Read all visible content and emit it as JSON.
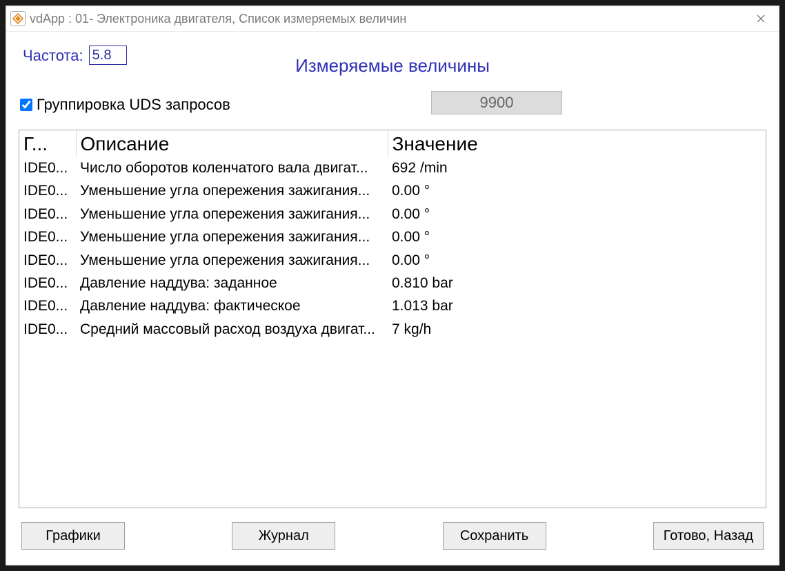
{
  "window": {
    "title": "vdApp : 01- Электроника двигателя,  Список измеряемых величин"
  },
  "top": {
    "freq_label": "Частота:",
    "freq_value": "5.8",
    "page_title": "Измеряемые величины",
    "group_checkbox_label": "Группировка UDS запросов",
    "group_checked": true,
    "counter_value": "9900"
  },
  "grid": {
    "headers": {
      "col1": "Г...",
      "col2": "Описание",
      "col3": "Значение"
    },
    "rows": [
      {
        "id": "IDE0...",
        "desc": "Число оборотов коленчатого вала двигат...",
        "value": "692 /min"
      },
      {
        "id": "IDE0...",
        "desc": "Уменьшение угла опережения зажигания...",
        "value": "0.00 °"
      },
      {
        "id": "IDE0...",
        "desc": "Уменьшение угла опережения зажигания...",
        "value": "0.00 °"
      },
      {
        "id": "IDE0...",
        "desc": "Уменьшение угла опережения зажигания...",
        "value": "0.00 °"
      },
      {
        "id": "IDE0...",
        "desc": "Уменьшение угла опережения зажигания...",
        "value": "0.00 °"
      },
      {
        "id": "IDE0...",
        "desc": "Давление наддува: заданное",
        "value": "0.810 bar"
      },
      {
        "id": "IDE0...",
        "desc": "Давление наддува: фактическое",
        "value": "1.013 bar"
      },
      {
        "id": "IDE0...",
        "desc": "Средний массовый расход воздуха двигат...",
        "value": "7 kg/h"
      }
    ]
  },
  "buttons": {
    "b1": "Графики",
    "b2": "Журнал",
    "b3": "Сохранить",
    "b4": "Готово, Назад"
  }
}
